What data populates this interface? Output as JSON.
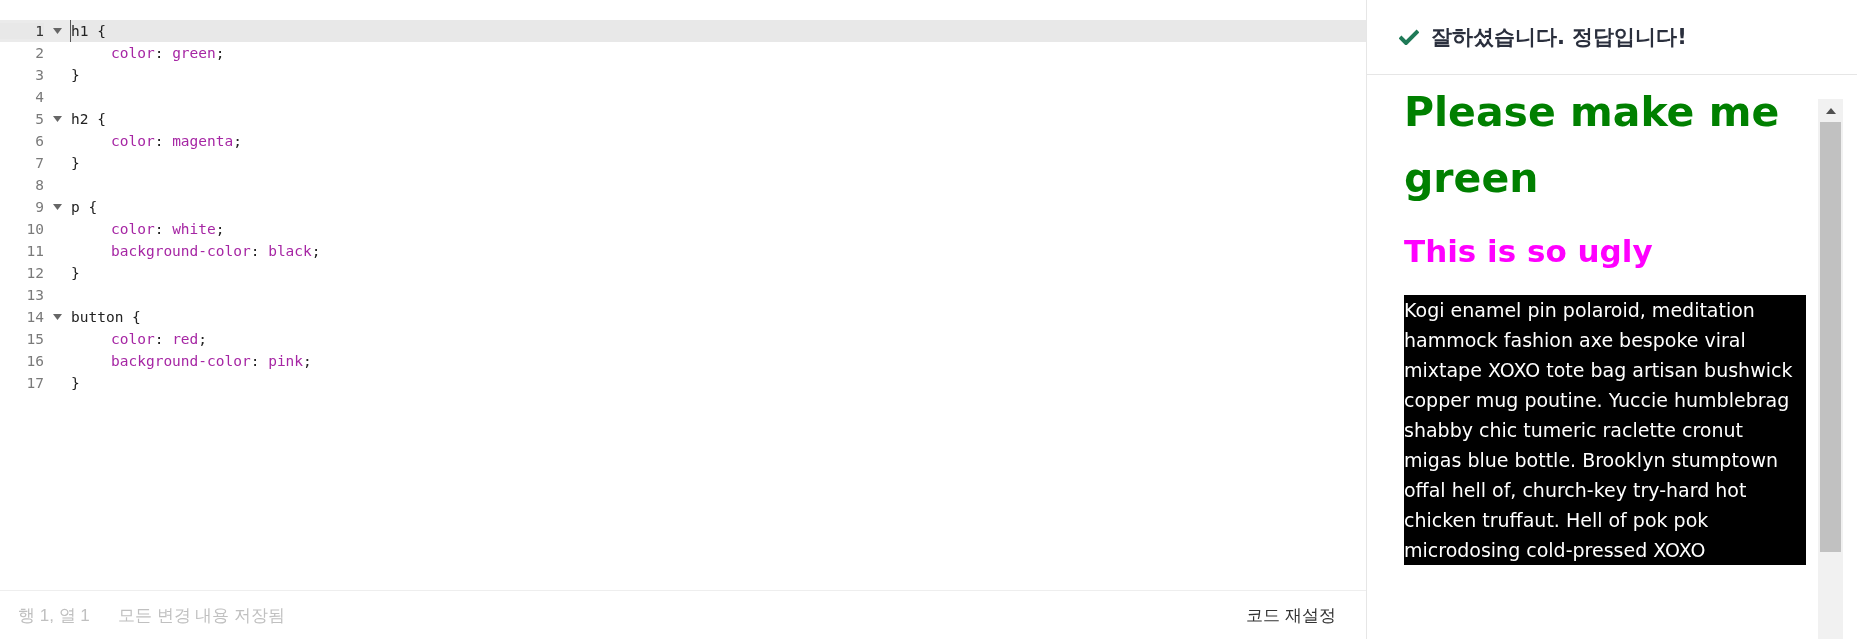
{
  "editor": {
    "lines": [
      {
        "number": "1",
        "foldable": true,
        "active": true,
        "indented": false,
        "tokens": [
          {
            "kind": "plain",
            "text": "h1 {"
          }
        ]
      },
      {
        "number": "2",
        "foldable": false,
        "active": false,
        "indented": true,
        "tokens": [
          {
            "kind": "keyword",
            "text": "color"
          },
          {
            "kind": "plain",
            "text": ": "
          },
          {
            "kind": "keyword",
            "text": "green"
          },
          {
            "kind": "plain",
            "text": ";"
          }
        ]
      },
      {
        "number": "3",
        "foldable": false,
        "active": false,
        "indented": false,
        "tokens": [
          {
            "kind": "plain",
            "text": "}"
          }
        ]
      },
      {
        "number": "4",
        "foldable": false,
        "active": false
      },
      {
        "number": "5",
        "foldable": true,
        "active": false,
        "indented": false,
        "tokens": [
          {
            "kind": "plain",
            "text": "h2 {"
          }
        ]
      },
      {
        "number": "6",
        "foldable": false,
        "active": false,
        "indented": true,
        "tokens": [
          {
            "kind": "keyword",
            "text": "color"
          },
          {
            "kind": "plain",
            "text": ": "
          },
          {
            "kind": "keyword",
            "text": "magenta"
          },
          {
            "kind": "plain",
            "text": ";"
          }
        ]
      },
      {
        "number": "7",
        "foldable": false,
        "active": false,
        "indented": false,
        "tokens": [
          {
            "kind": "plain",
            "text": "}"
          }
        ]
      },
      {
        "number": "8",
        "foldable": false,
        "active": false
      },
      {
        "number": "9",
        "foldable": true,
        "active": false,
        "indented": false,
        "tokens": [
          {
            "kind": "plain",
            "text": "p {"
          }
        ]
      },
      {
        "number": "10",
        "foldable": false,
        "active": false,
        "indented": true,
        "tokens": [
          {
            "kind": "keyword",
            "text": "color"
          },
          {
            "kind": "plain",
            "text": ": "
          },
          {
            "kind": "keyword",
            "text": "white"
          },
          {
            "kind": "plain",
            "text": ";"
          }
        ]
      },
      {
        "number": "11",
        "foldable": false,
        "active": false,
        "indented": true,
        "tokens": [
          {
            "kind": "keyword",
            "text": "background-color"
          },
          {
            "kind": "plain",
            "text": ": "
          },
          {
            "kind": "keyword",
            "text": "black"
          },
          {
            "kind": "plain",
            "text": ";"
          }
        ]
      },
      {
        "number": "12",
        "foldable": false,
        "active": false,
        "indented": false,
        "tokens": [
          {
            "kind": "plain",
            "text": "}"
          }
        ]
      },
      {
        "number": "13",
        "foldable": false,
        "active": false
      },
      {
        "number": "14",
        "foldable": true,
        "active": false,
        "indented": false,
        "tokens": [
          {
            "kind": "plain",
            "text": "button {"
          }
        ]
      },
      {
        "number": "15",
        "foldable": false,
        "active": false,
        "indented": true,
        "tokens": [
          {
            "kind": "keyword",
            "text": "color"
          },
          {
            "kind": "plain",
            "text": ": "
          },
          {
            "kind": "keyword",
            "text": "red"
          },
          {
            "kind": "plain",
            "text": ";"
          }
        ]
      },
      {
        "number": "16",
        "foldable": false,
        "active": false,
        "indented": true,
        "tokens": [
          {
            "kind": "keyword",
            "text": "background-color"
          },
          {
            "kind": "plain",
            "text": ": "
          },
          {
            "kind": "keyword",
            "text": "pink"
          },
          {
            "kind": "plain",
            "text": ";"
          }
        ]
      },
      {
        "number": "17",
        "foldable": false,
        "active": false,
        "indented": false,
        "tokens": [
          {
            "kind": "plain",
            "text": "}"
          }
        ]
      }
    ]
  },
  "status_bar": {
    "cursor": "행 1, 열 1",
    "save_state": "모든 변경 내용 저장됨",
    "reset_button": "코드 재설정"
  },
  "result": {
    "message": "잘하셨습니다. 정답입니다!"
  },
  "preview": {
    "heading": "Please make me green",
    "subheading": "This is so ugly",
    "paragraph": "Kogi enamel pin polaroid, meditation hammock fashion axe bespoke viral mixtape XOXO tote bag artisan bushwick copper mug poutine. Yuccie humblebrag shabby chic tumeric raclette cronut migas blue bottle. Brooklyn stumptown offal hell of, church-key try-hard hot chicken truffaut. Hell of pok pok microdosing cold-pressed XOXO"
  }
}
